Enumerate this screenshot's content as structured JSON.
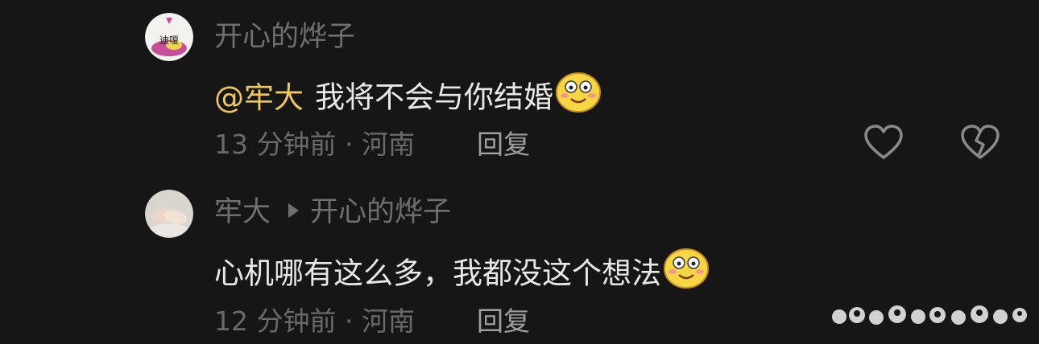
{
  "comments": [
    {
      "username": "开心的烨子",
      "avatar_text": "迪嗄",
      "mention": "@牢大",
      "text": "我将不会与你结婚",
      "emoji": "smile-emoji",
      "time": "13 分钟前 · 河南",
      "reply_label": "回复",
      "icons": [
        "heart-outline-icon",
        "broken-heart-icon"
      ]
    },
    {
      "username": "牢大",
      "reply_to": "开心的烨子",
      "text": "心机哪有这么多，我都没这个想法",
      "emoji": "smile-emoji",
      "time": "12 分钟前 · 河南",
      "reply_label": "回复"
    }
  ],
  "colors": {
    "background": "#161616",
    "mention": "#f1c75c",
    "text": "#e8e8e8",
    "muted": "#6f6f6f"
  }
}
